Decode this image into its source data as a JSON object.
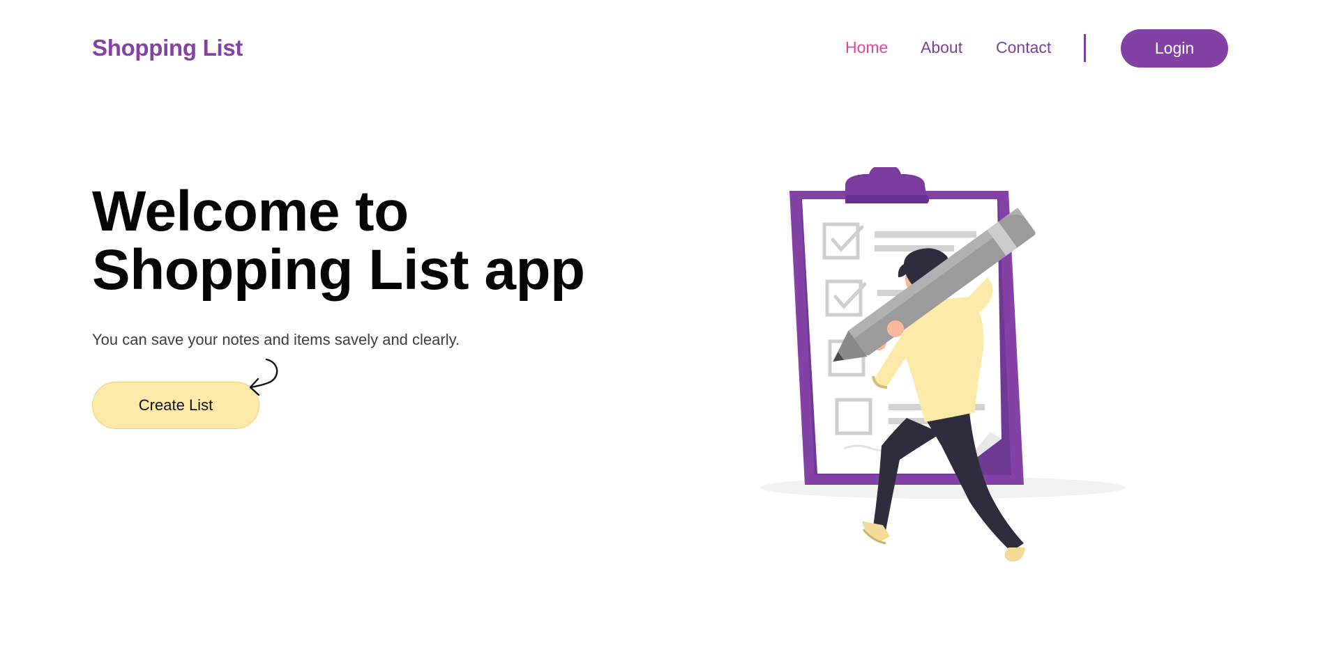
{
  "header": {
    "brand": "Shopping List",
    "nav": [
      {
        "label": "Home",
        "active": true
      },
      {
        "label": "About",
        "active": false
      },
      {
        "label": "Contact",
        "active": false
      }
    ],
    "login_label": "Login"
  },
  "hero": {
    "title_line1": "Welcome to",
    "title_line2": "Shopping List app",
    "subtitle": "You can save your notes and items savely and clearly.",
    "cta_label": "Create List"
  },
  "illustration": {
    "icon": "clipboard-checklist-person-illustration"
  },
  "colors": {
    "brand": "#8442a6",
    "nav_active": "#e0479e",
    "cta_bg": "#fde9a8"
  }
}
